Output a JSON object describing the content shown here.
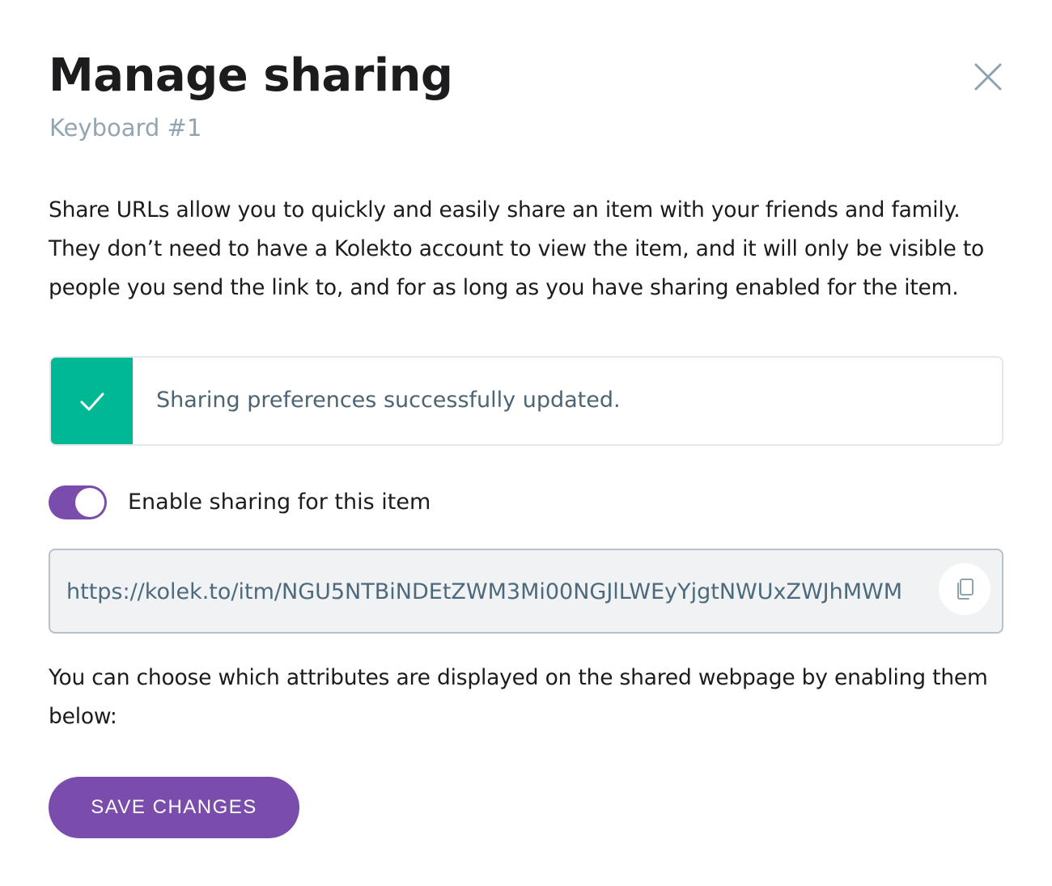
{
  "modal": {
    "title": "Manage sharing",
    "subtitle": "Keyboard #1",
    "close_icon": "close-icon",
    "description": "Share URLs allow you to quickly and easily share an item with your friends and family. They don’t need to have a Kolekto account to view the item, and it will only be visible to people you send the link to, and for as long as you have sharing enabled for the item."
  },
  "alert": {
    "icon": "checkmark-icon",
    "message": "Sharing preferences successfully updated.",
    "accent_color": "#00b894"
  },
  "sharing_toggle": {
    "label": "Enable sharing for this item",
    "enabled": true,
    "color": "#7a4cab"
  },
  "share_url": {
    "value": "https://kolek.to/itm/NGU5NTBiNDEtZWM3Mi00NGJlLWEyYjgtNWUxZWJhMWM",
    "copy_icon": "copy-icon"
  },
  "attributes_text": "You can choose which attributes are displayed on the shared webpage by enabling them below:",
  "save_button": {
    "label": "SAVE CHANGES",
    "color": "#7a4cab"
  }
}
